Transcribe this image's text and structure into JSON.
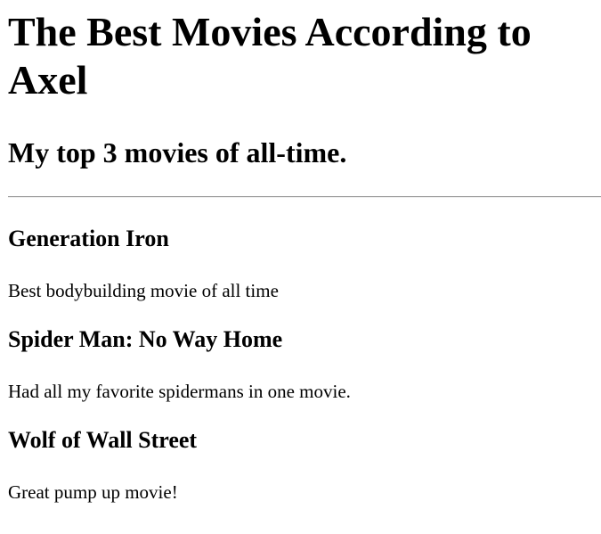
{
  "page": {
    "title": "The Best Movies According to Axel",
    "subtitle": "My top 3 movies of all-time."
  },
  "movies": [
    {
      "name": "Generation Iron",
      "description": "Best bodybuilding movie of all time"
    },
    {
      "name": "Spider Man: No Way Home",
      "description": "Had all my favorite spidermans in one movie."
    },
    {
      "name": "Wolf of Wall Street",
      "description": "Great pump up movie!"
    }
  ]
}
